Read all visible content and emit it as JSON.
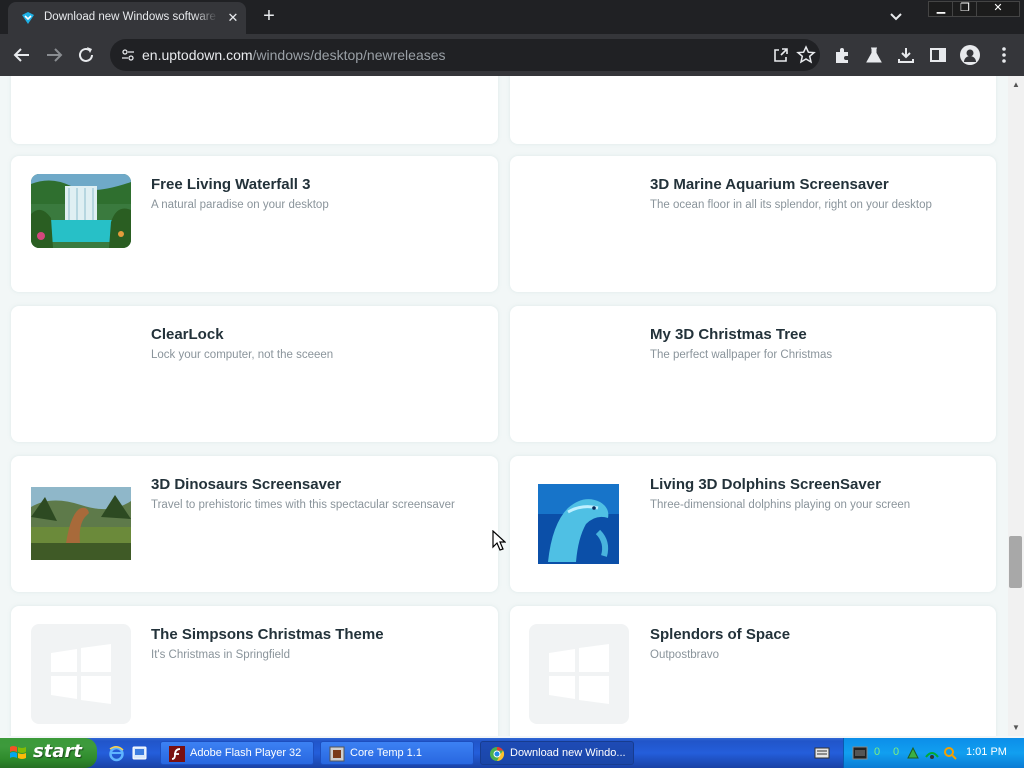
{
  "browser": {
    "tab_title": "Download new Windows software",
    "url_host": "en.uptodown.com",
    "url_path": "/windows/desktop/newreleases"
  },
  "apps": [
    {
      "name": "Free Living Waterfall 3",
      "desc": "A natural paradise on your desktop"
    },
    {
      "name": "3D Marine Aquarium Screensaver",
      "desc": "The ocean floor in all its splendor, right on your desktop"
    },
    {
      "name": "ClearLock",
      "desc": "Lock your computer, not the sceeen"
    },
    {
      "name": "My 3D Christmas Tree",
      "desc": "The perfect wallpaper for Christmas"
    },
    {
      "name": "3D Dinosaurs Screensaver",
      "desc": "Travel to prehistoric times with this spectacular screensaver"
    },
    {
      "name": "Living 3D Dolphins ScreenSaver",
      "desc": "Three-dimensional dolphins playing on your screen"
    },
    {
      "name": "The Simpsons Christmas Theme",
      "desc": "It's Christmas in Springfield"
    },
    {
      "name": "Splendors of Space",
      "desc": "Outpostbravo"
    }
  ],
  "taskbar": {
    "start_label": "start",
    "tasks": [
      {
        "label": "Adobe Flash Player 32"
      },
      {
        "label": "Core Temp 1.1"
      },
      {
        "label": "Download new Windo..."
      }
    ],
    "tray_values": [
      "0",
      "0"
    ],
    "clock": "1:01 PM"
  }
}
